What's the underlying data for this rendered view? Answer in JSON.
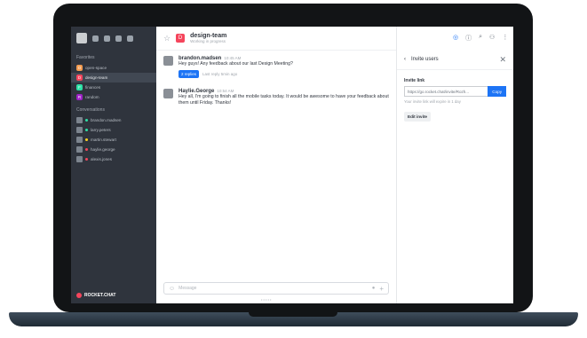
{
  "sidebar": {
    "section_favorites": "Favorites",
    "rooms": [
      {
        "label": "open-space",
        "initial": "O",
        "color": "#f29b50"
      },
      {
        "label": "design-team",
        "initial": "D",
        "color": "#f5455c"
      },
      {
        "label": "finances",
        "initial": "F",
        "color": "#2de0a5"
      },
      {
        "label": "random",
        "initial": "R",
        "color": "#9f22c7"
      }
    ],
    "section_conversations": "Conversations",
    "conversations": [
      {
        "label": "brandon.madsen",
        "status_color": "#2de0a5"
      },
      {
        "label": "larry.peters",
        "status_color": "#2de0a5"
      },
      {
        "label": "martin.stewart",
        "status_color": "#ffd21f"
      },
      {
        "label": "haylie.george",
        "status_color": "#f5455c"
      },
      {
        "label": "alexis.jones",
        "status_color": "#f5455c"
      }
    ],
    "footer_brand": "ROCKET.CHAT"
  },
  "header": {
    "room_title": "design-team",
    "room_topic": "Working in progress",
    "accent_color": "#1d74f5"
  },
  "messages": [
    {
      "author": "brandon.madsen",
      "time": "10:45 AM",
      "text": "Hey guys! Any feedback about our last Design Meeting?",
      "replies_label": "2 replies",
      "last_reply": "Last reply 5min ago"
    },
    {
      "author": "Haylie.George",
      "time": "10:54 AM",
      "text": "Hey all, I'm going to finish all the mobile tasks today. It would be awesome to have your feedback about them until Friday. Thanks!"
    }
  ],
  "composer": {
    "placeholder": "Message"
  },
  "invite_panel": {
    "title": "Invite users",
    "link_label": "Invite link",
    "link_value": "https://go.rocket.chat/invite/Rozh...",
    "copy_label": "Copy",
    "note": "Your invite link will expire in 1 day",
    "edit_label": "Edit invite"
  }
}
